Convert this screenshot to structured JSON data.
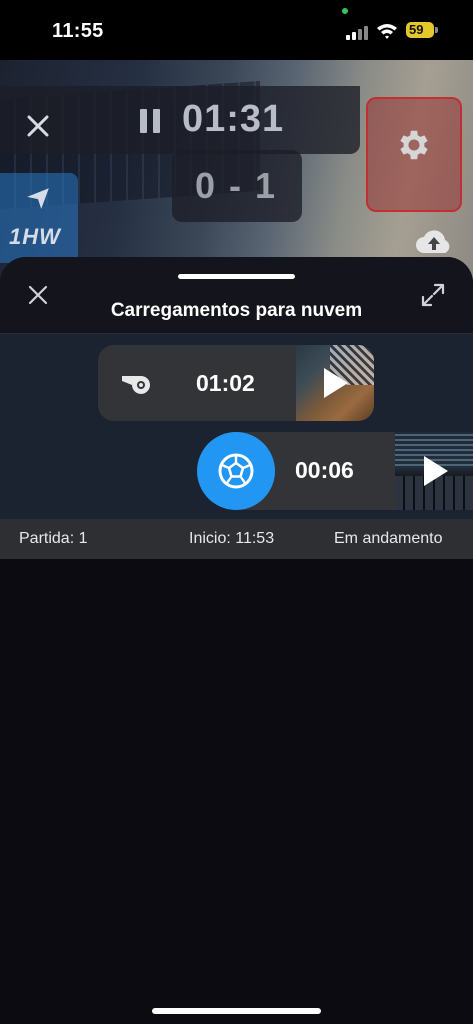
{
  "status_bar": {
    "time": "11:55",
    "battery": "59"
  },
  "camera": {
    "timer": "01:31",
    "score": "0 - 1",
    "logo_text": "1HW"
  },
  "sheet": {
    "title": "Carregamentos para nuvem",
    "uploads": [
      {
        "event_icon": "whistle-icon",
        "time": "01:02"
      },
      {
        "event_icon": "soccer-ball-icon",
        "time": "00:06"
      }
    ],
    "info": {
      "match": "Partida: 1",
      "start": "Inicio: 11:53",
      "status": "Em andamento"
    }
  },
  "colors": {
    "accent_blue": "#2196f3",
    "settings_red": "#c82828",
    "battery_yellow": "#e6c72c"
  }
}
